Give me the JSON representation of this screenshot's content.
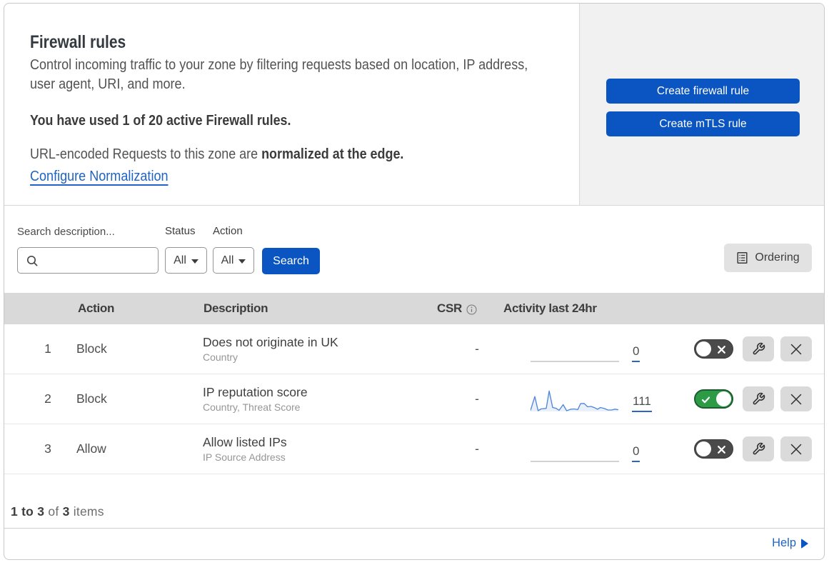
{
  "header": {
    "title": "Firewall rules",
    "description_line1": "Control incoming traffic to your zone by filtering requests based on location, IP address,",
    "description_line2": "user agent, URI, and more.",
    "usage": "You have used 1 of 20 active Firewall rules.",
    "normalization_prefix": "URL-encoded Requests to this zone are ",
    "normalization_bold": "normalized at the edge.",
    "normalization_link": "Configure Normalization"
  },
  "actions": {
    "create_firewall_rule": "Create firewall rule",
    "create_mtls_rule": "Create mTLS rule"
  },
  "filters": {
    "search_label": "Search description...",
    "search_value": "",
    "status_label": "Status",
    "status_value": "All",
    "action_label": "Action",
    "action_value": "All",
    "search_button": "Search",
    "ordering_button": "Ordering"
  },
  "table": {
    "columns": {
      "action": "Action",
      "description": "Description",
      "csr": "CSR",
      "activity": "Activity last 24hr"
    },
    "rows": [
      {
        "index": "1",
        "action": "Block",
        "description": "Does not originate in UK",
        "criteria": "Country",
        "csr": "-",
        "activity_count": "0",
        "has_sparkline": false,
        "enabled": false
      },
      {
        "index": "2",
        "action": "Block",
        "description": "IP reputation score",
        "criteria": "Country, Threat Score",
        "csr": "-",
        "activity_count": "111",
        "has_sparkline": true,
        "enabled": true
      },
      {
        "index": "3",
        "action": "Allow",
        "description": "Allow listed IPs",
        "criteria": "IP Source Address",
        "csr": "-",
        "activity_count": "0",
        "has_sparkline": false,
        "enabled": false
      }
    ]
  },
  "chart_data": {
    "type": "line",
    "title": "Activity last 24hr sparkline (rule 2)",
    "total": 111,
    "points": [
      [
        0,
        29.4
      ],
      [
        6,
        10.2
      ],
      [
        10.6,
        30
      ],
      [
        14.7,
        27.5
      ],
      [
        22,
        26.7
      ],
      [
        26.1,
        2.4
      ],
      [
        31,
        25.5
      ],
      [
        35.9,
        26.7
      ],
      [
        40,
        29.4
      ],
      [
        45.7,
        21.5
      ],
      [
        50.6,
        30
      ],
      [
        56.3,
        27.9
      ],
      [
        61.2,
        27.5
      ],
      [
        66.1,
        28.5
      ],
      [
        70.1,
        20.1
      ],
      [
        75,
        19.8
      ],
      [
        79.9,
        24.5
      ],
      [
        84.8,
        24
      ],
      [
        89.7,
        25.8
      ],
      [
        93.8,
        27.9
      ],
      [
        97.9,
        25.5
      ],
      [
        103.6,
        27
      ],
      [
        108.5,
        29
      ],
      [
        113.4,
        29
      ],
      [
        118.3,
        27.8
      ],
      [
        122.4,
        28.6
      ]
    ]
  },
  "footer": {
    "range": "1 to 3",
    "of": "of",
    "total": "3",
    "items": "items"
  },
  "help": {
    "label": "Help"
  },
  "colors": {
    "primary_blue": "#0a55c2",
    "link_blue": "#2064c4",
    "toggle_green": "#2d9b46",
    "toggle_grey": "#4a4a4a",
    "header_grey": "#d9d9d9",
    "panel_grey": "#f1f1f1",
    "sparkline_blue": "#4f87d9"
  }
}
